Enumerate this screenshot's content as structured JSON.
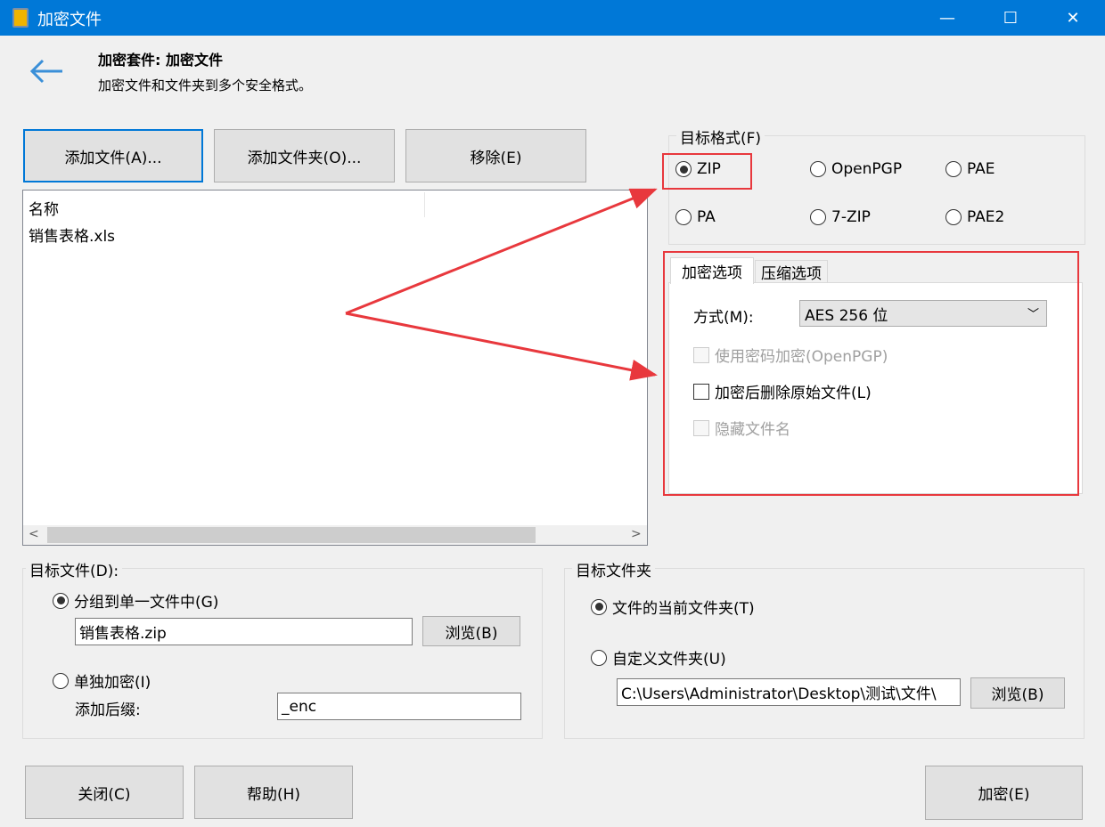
{
  "window": {
    "title": "加密文件",
    "minimize": "—",
    "maximize": "☐",
    "close": "✕"
  },
  "header": {
    "title": "加密套件: 加密文件",
    "subtitle": "加密文件和文件夹到多个安全格式。"
  },
  "toolbar": {
    "add_file": "添加文件(A)...",
    "add_folder": "添加文件夹(O)...",
    "remove": "移除(E)"
  },
  "file_list": {
    "column": "名称",
    "items": [
      "销售表格.xls"
    ]
  },
  "target_format": {
    "legend": "目标格式(F)",
    "options": [
      "ZIP",
      "OpenPGP",
      "PAE",
      "PA",
      "7-ZIP",
      "PAE2"
    ],
    "selected": "ZIP"
  },
  "tabs": [
    "加密选项",
    "压缩选项"
  ],
  "encrypt_options": {
    "method_label": "方式(M):",
    "method_value": "AES 256 位",
    "use_password_openpgp": "使用密码加密(OpenPGP)",
    "delete_original": "加密后删除原始文件(L)",
    "hide_filename": "隐藏文件名"
  },
  "target_file": {
    "legend": "目标文件(D):",
    "group_single": "分组到单一文件中(G)",
    "filename": "销售表格.zip",
    "browse": "浏览(B)",
    "individual": "单独加密(I)",
    "suffix_label": "添加后缀:",
    "suffix": "_enc"
  },
  "target_folder": {
    "legend": "目标文件夹",
    "current": "文件的当前文件夹(T)",
    "custom": "自定义文件夹(U)",
    "path": "C:\\Users\\Administrator\\Desktop\\测试\\文件\\",
    "browse": "浏览(B)"
  },
  "footer": {
    "close": "关闭(C)",
    "help": "帮助(H)",
    "encrypt": "加密(E)"
  },
  "colors": {
    "titlebar": "#0078d7",
    "highlight": "#e8383d"
  }
}
